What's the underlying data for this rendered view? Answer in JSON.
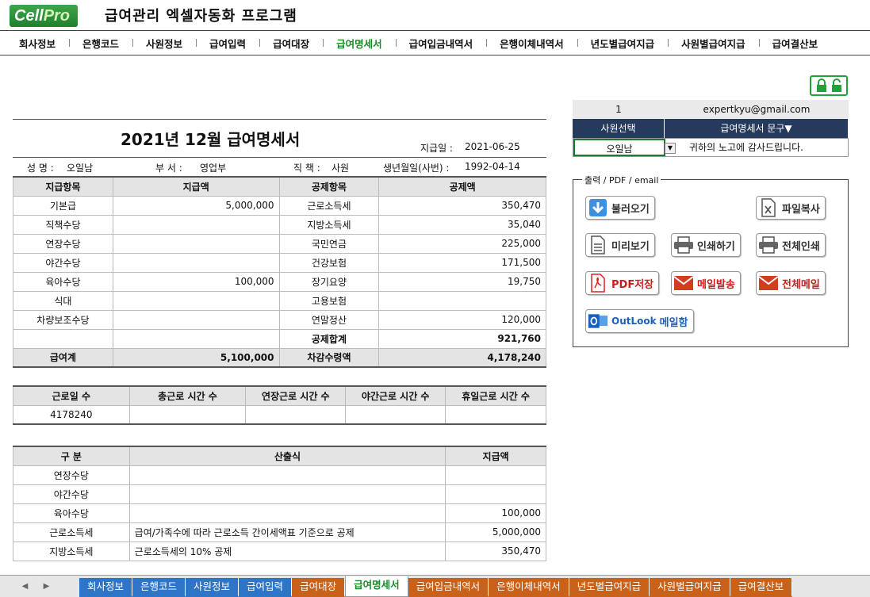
{
  "app": {
    "logo_cell": "Cell",
    "logo_pro": "Pro",
    "title": "급여관리 엑셀자동화 프로그램"
  },
  "menu": {
    "items": [
      "회사정보",
      "은행코드",
      "사원정보",
      "급여입력",
      "급여대장",
      "급여명세서",
      "급여입금내역서",
      "은행이체내역서",
      "년도별급여지급",
      "사원별급여지급",
      "급여결산보"
    ],
    "active_index": 5
  },
  "payslip": {
    "heading": "2021년 12월 급여명세서",
    "pay_date_label": "지급일 :",
    "pay_date": "2021-06-25",
    "name_label": "성 명 :",
    "name": "오일남",
    "dept_label": "부 서 :",
    "dept": "영업부",
    "position_label": "직 책 :",
    "position": "사원",
    "birth_label": "생년월일(사번) :",
    "birth": "1992-04-14",
    "columns": [
      "지급항목",
      "지급액",
      "공제항목",
      "공제액"
    ],
    "rows": [
      [
        "기본급",
        "5,000,000",
        "근로소득세",
        "350,470"
      ],
      [
        "직책수당",
        "",
        "지방소득세",
        "35,040"
      ],
      [
        "연장수당",
        "",
        "국민연금",
        "225,000"
      ],
      [
        "야간수당",
        "",
        "건강보험",
        "171,500"
      ],
      [
        "육아수당",
        "100,000",
        "장기요양",
        "19,750"
      ],
      [
        "식대",
        "",
        "고용보험",
        ""
      ],
      [
        "차량보조수당",
        "",
        "연말정산",
        "120,000"
      ],
      [
        "",
        "",
        "공제합계",
        "921,760"
      ]
    ],
    "total_row": [
      "급여계",
      "5,100,000",
      "차감수령액",
      "4,178,240"
    ]
  },
  "work": {
    "columns": [
      "근로일 수",
      "총근로 시간 수",
      "연장근로 시간 수",
      "야간근로 시간 수",
      "휴일근로 시간 수"
    ],
    "values": [
      "4178240",
      "",
      "",
      "",
      ""
    ]
  },
  "calc": {
    "columns": [
      "구  분",
      "산출식",
      "지급액"
    ],
    "rows": [
      [
        "연장수당",
        "",
        ""
      ],
      [
        "야간수당",
        "",
        ""
      ],
      [
        "육아수당",
        "",
        "100,000"
      ],
      [
        "근로소득세",
        "급여/가족수에 따라 근로소득 간이세액표 기준으로 공제",
        "5,000,000"
      ],
      [
        "지방소득세",
        "근로소득세의 10% 공제",
        "350,470"
      ]
    ]
  },
  "selector": {
    "index": "1",
    "email": "expertkyu@gmail.com",
    "col1_header": "사원선택",
    "col2_header": "급여명세서 문구▼",
    "employee": "오일남",
    "message": "귀하의 노고에 감사드립니다."
  },
  "output": {
    "legend": "출력 / PDF / email",
    "load": "불러오기",
    "copy_file": "파일복사",
    "preview": "미리보기",
    "print": "인쇄하기",
    "print_all": "전체인쇄",
    "pdf": "PDF저장",
    "send_mail": "메일발송",
    "mail_all": "전체메일",
    "outlook_brand": "OutLook",
    "outlook_label": "메일함"
  },
  "sheets": {
    "tabs": [
      "회사정보",
      "은행코드",
      "사원정보",
      "급여입력",
      "급여대장",
      "급여명세서",
      "급여입금내역서",
      "은행이체내역서",
      "년도별급여지급",
      "사원별급여지급",
      "급여결산보"
    ],
    "colors": [
      "blue",
      "blue",
      "blue",
      "blue",
      "orange",
      "active",
      "orange",
      "orange",
      "orange",
      "orange",
      "orange"
    ]
  },
  "colors": {
    "accent_green": "#1a8a2a",
    "header_navy": "#263a5e",
    "tab_blue": "#2e75c7",
    "tab_orange": "#c8621a"
  }
}
